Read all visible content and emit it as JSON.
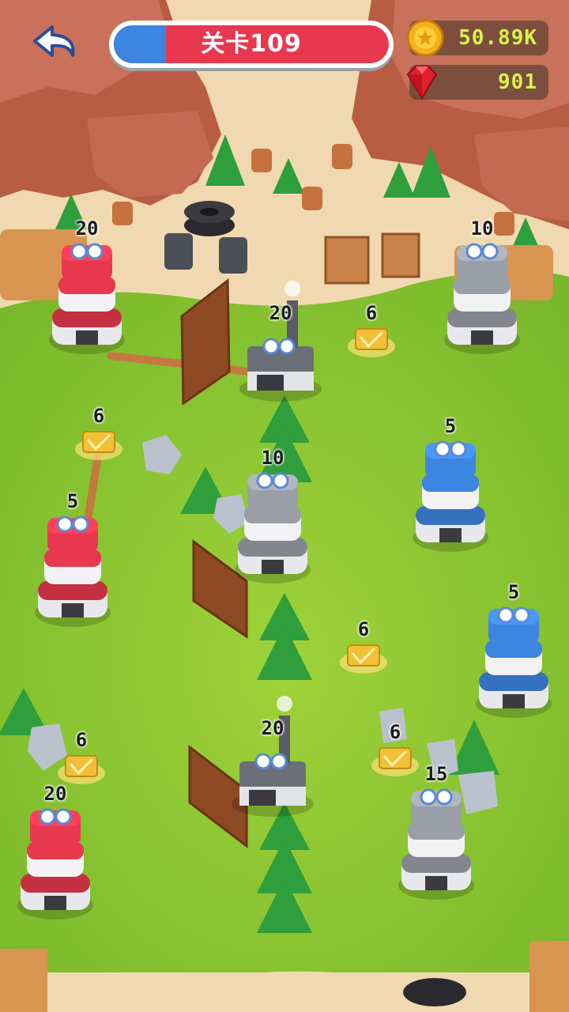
{
  "hud": {
    "level_label": "关卡109",
    "level_progress": 0.19,
    "coins": "50.89K",
    "gems": "901",
    "colors": {
      "player": "#3d85e0",
      "enemy": "#e8384f",
      "neutral": "#9a9ea6",
      "coin_text": "#d8f24a"
    }
  },
  "icons": {
    "back": "undo-arrow-icon",
    "coin": "coin-icon",
    "gem": "ruby-gem-icon"
  },
  "buildings": [
    {
      "type": "tower",
      "team": "enemy",
      "units": "20"
    },
    {
      "type": "tower",
      "team": "neutral",
      "units": "10"
    },
    {
      "type": "factory",
      "team": "neutral",
      "units": "20"
    },
    {
      "type": "gold",
      "team": "neutral",
      "units": "6"
    },
    {
      "type": "gold",
      "team": "neutral",
      "units": "6"
    },
    {
      "type": "tower",
      "team": "player",
      "units": "5"
    },
    {
      "type": "tower",
      "team": "neutral",
      "units": "10"
    },
    {
      "type": "tower",
      "team": "enemy",
      "units": "5"
    },
    {
      "type": "gold",
      "team": "neutral",
      "units": "6"
    },
    {
      "type": "tower",
      "team": "player",
      "units": "5"
    },
    {
      "type": "factory",
      "team": "neutral",
      "units": "20"
    },
    {
      "type": "gold",
      "team": "neutral",
      "units": "6"
    },
    {
      "type": "gold",
      "team": "neutral",
      "units": "6"
    },
    {
      "type": "tower",
      "team": "enemy",
      "units": "20"
    },
    {
      "type": "tower",
      "team": "neutral",
      "units": "15"
    }
  ]
}
